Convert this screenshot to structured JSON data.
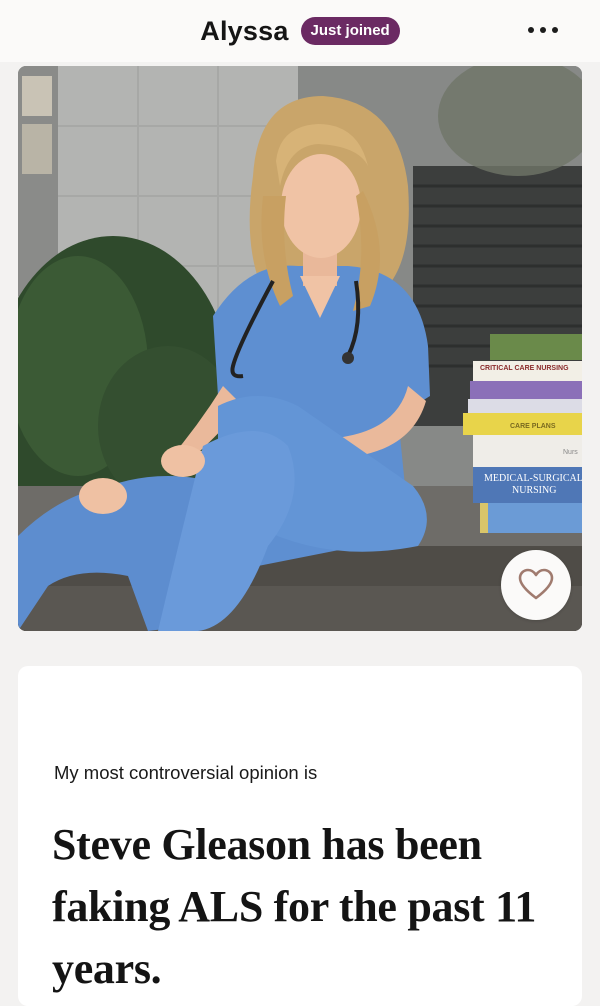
{
  "header": {
    "name": "Alyssa",
    "badge": "Just joined",
    "more_icon": "more-horizontal-icon"
  },
  "photo": {
    "subject": "woman in blue scrubs with stethoscope seated on step beside stack of nursing books",
    "book_spines": [
      "CRITICAL CARE NURSING",
      "CARE PLANS",
      "Nurs",
      "MEDICAL-SURGICAL",
      "NURSING"
    ],
    "like_icon": "heart-icon"
  },
  "prompt": {
    "label": "My most controversial opinion is",
    "answer": "Steve Gleason has been faking ALS for the past 11 years."
  },
  "colors": {
    "badge_bg": "#6b2a63",
    "scrubs": "#5b8ccf",
    "page_bg": "#f3f2f1"
  }
}
